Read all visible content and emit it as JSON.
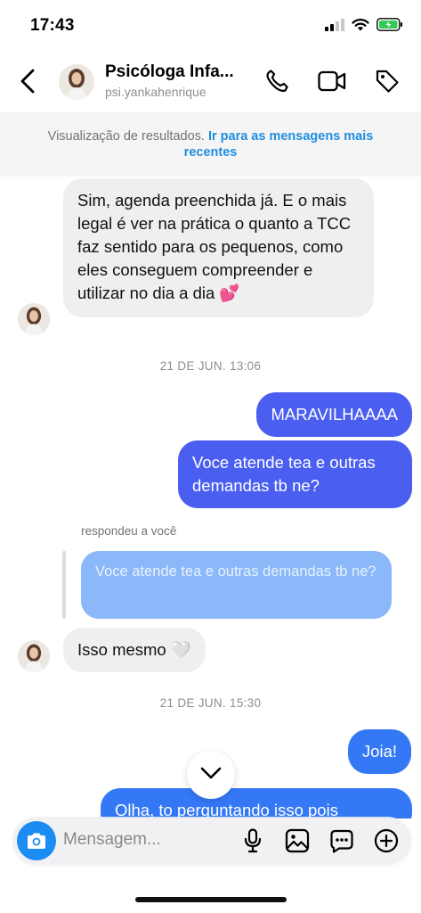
{
  "status_bar": {
    "time": "17:43"
  },
  "header": {
    "name": "Psicóloga Infa...",
    "username": "psi.yankahenrique"
  },
  "banner": {
    "text": "Visualização de resultados.",
    "link": "Ir para as mensagens mais recentes"
  },
  "messages": [
    {
      "type": "incoming",
      "text": "Sim, agenda preenchida já. E o mais legal é ver na prática o quanto a TCC faz sentido para os pequenos, como eles conseguem compreender e utilizar no dia a dia 💕"
    },
    {
      "type": "timestamp",
      "text": "21 DE JUN. 13:06"
    },
    {
      "type": "outgoing",
      "text": "MARAVILHAAAA"
    },
    {
      "type": "outgoing",
      "text": "Voce atende tea e outras demandas tb ne?"
    },
    {
      "type": "reply_label",
      "text": "respondeu a você"
    },
    {
      "type": "quoted",
      "text": "Voce atende tea e outras demandas tb ne?"
    },
    {
      "type": "incoming",
      "text": "Isso mesmo 🤍"
    },
    {
      "type": "timestamp",
      "text": "21 DE JUN. 15:30"
    },
    {
      "type": "outgoing",
      "text": "Joia!"
    },
    {
      "type": "outgoing",
      "text": "Olha, to perguntando isso pois"
    }
  ],
  "composer": {
    "placeholder": "Mensagem..."
  },
  "colors": {
    "outgoing": "#4a5ef0",
    "outgoing_alt": "#3478f6",
    "incoming": "#efeff0",
    "link": "#1f8ee0",
    "camera": "#1b8cf2"
  }
}
